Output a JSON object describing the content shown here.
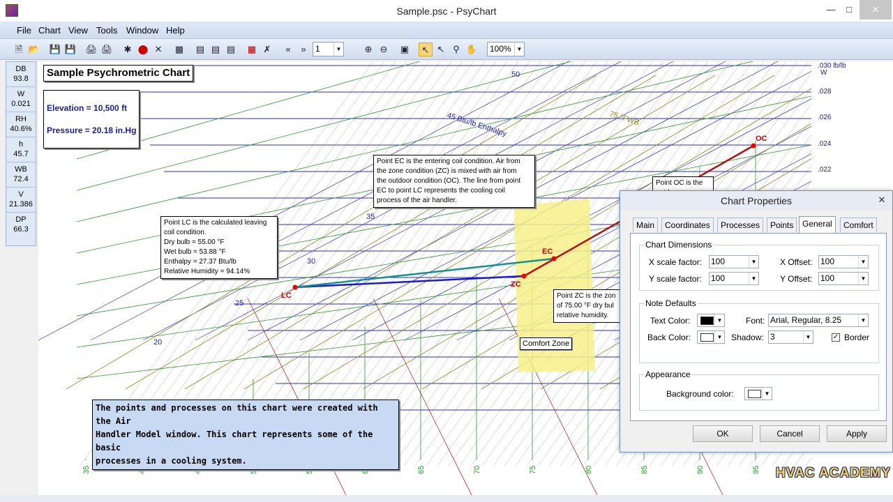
{
  "window": {
    "title": "Sample.psc - PsyChart"
  },
  "menu": [
    "File",
    "Chart",
    "View",
    "Tools",
    "Window",
    "Help"
  ],
  "toolbar": {
    "page": "1",
    "zoom": "100%"
  },
  "readout": [
    {
      "label": "DB",
      "value": "93.8"
    },
    {
      "label": "W",
      "value": "0.021"
    },
    {
      "label": "RH",
      "value": "40.6%"
    },
    {
      "label": "h",
      "value": "45.7"
    },
    {
      "label": "WB",
      "value": "72.4"
    },
    {
      "label": "V",
      "value": "21.386"
    },
    {
      "label": "DP",
      "value": "66.3"
    }
  ],
  "chart": {
    "title": "Sample Psychrometric Chart",
    "elevation": "Elevation = 10,500 ft",
    "pressure": "Pressure = 20.18 in.Hg",
    "w_unit": ".030 lb/lb",
    "w_axis": "W",
    "w_ticks": [
      ".028",
      ".026",
      ".024",
      ".022"
    ],
    "db_ticks": [
      "35",
      "40",
      "45",
      "50",
      "55",
      "60",
      "65",
      "70",
      "75",
      "80",
      "85",
      "90",
      "95"
    ],
    "enthalpy_label": "45 Btu/lb\nEnthalpy",
    "enthalpy_ticks": [
      "50",
      "35",
      "30",
      "25",
      "20"
    ],
    "wb_label": "75 °FWB",
    "points": {
      "OC": "OC",
      "EC": "EC",
      "ZC": "ZC",
      "LC": "LC"
    },
    "note_ec": "Point EC is the entering coil condition.  Air from\nthe zone condition (ZC) is mixed with air from\nthe outdoor condition (OC).  The line from point\nEC to point LC represents the cooling coil\nprocess of the air handler.",
    "note_lc": "Point LC is the calculated leaving\ncoil condition.\nDry bulb = 55.00 °F\nWet bulb = 53.88 °F\nEnthalpy = 27.37 Btu/lb\nRelative Humidity = 94.14%",
    "note_zc": "Point ZC is the zon\nof 75.00 °F dry bul\nrelative humidity.",
    "note_oc": "Point OC is the outdoor",
    "comfort_zone": "Comfort Zone",
    "info_box": "The points and processes on this chart were created with the Air\nHandler Model window.  This chart represents some of the basic\nprocesses in a cooling system."
  },
  "dialog": {
    "title": "Chart Properties",
    "tabs": [
      "Main",
      "Coordinates",
      "Processes",
      "Points",
      "General",
      "Comfort"
    ],
    "active_tab": "General",
    "dimensions_group": "Chart Dimensions",
    "x_scale_label": "X scale factor:",
    "x_scale_value": "100",
    "y_scale_label": "Y scale factor:",
    "y_scale_value": "100",
    "x_offset_label": "X Offset:",
    "x_offset_value": "100",
    "y_offset_label": "Y Offset:",
    "y_offset_value": "100",
    "note_group": "Note Defaults",
    "text_color_label": "Text Color:",
    "font_label": "Font:",
    "font_value": "Arial, Regular, 8.25",
    "back_color_label": "Back Color:",
    "shadow_label": "Shadow:",
    "shadow_value": "3",
    "border_label": "Border",
    "appearance_group": "Appearance",
    "bg_color_label": "Background color:",
    "ok": "OK",
    "cancel": "Cancel",
    "apply": "Apply"
  },
  "watermark": "HVAC ACADEMY",
  "colors": {
    "blue": "#1a1ad0",
    "green": "#2a9a2a",
    "red": "#b01010",
    "teal": "#159090",
    "comfort": "#f6f08a"
  }
}
